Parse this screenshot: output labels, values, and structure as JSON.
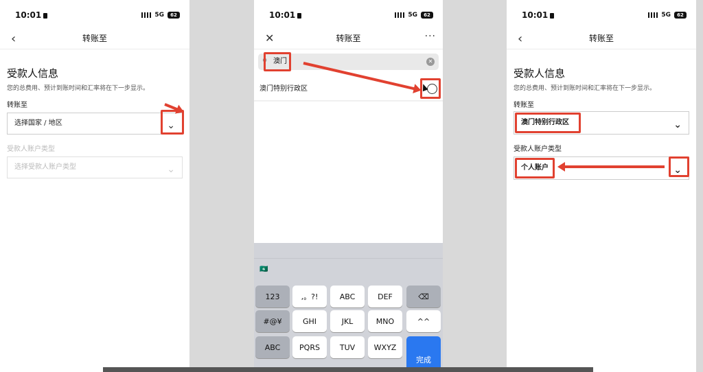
{
  "status": {
    "time": "10:01",
    "network": "5G",
    "battery": "62"
  },
  "panel1": {
    "nav_title": "转账至",
    "back_icon": "chevron-left-icon",
    "section_title": "受款人信息",
    "subtitle": "您的总费用、预计到账时间和汇率将在下一步显示。",
    "transfer_label": "转账至",
    "country_value": "选择国家 / 地区",
    "account_type_label": "受款人账户类型",
    "account_type_placeholder": "选择受款人账户类型"
  },
  "panel2": {
    "nav_title": "转账至",
    "close_icon": "close-icon",
    "more_label": "···",
    "search_value": "澳门",
    "result_label": "澳门特别行政区",
    "emoji": "🇲🇴",
    "keys": {
      "k123": "123",
      "punct": ",。?!",
      "abc": "ABC",
      "def": "DEF",
      "del": "⌫",
      "sym": "#@¥",
      "ghi": "GHI",
      "jkl": "JKL",
      "mno": "MNO",
      "face": "^^",
      "abc2": "ABC",
      "pqrs": "PQRS",
      "tuv": "TUV",
      "wxyz": "WXYZ",
      "done": "完成"
    }
  },
  "panel3": {
    "nav_title": "转账至",
    "section_title": "受款人信息",
    "subtitle": "您的总费用、预计到账时间和汇率将在下一步显示。",
    "transfer_label": "转账至",
    "country_value": "澳门特别行政区",
    "account_type_label": "受款人账户类型",
    "account_type_value": "个人账户"
  },
  "colors": {
    "annotation_red": "#e14130",
    "keyboard_blue": "#2a78f0"
  }
}
